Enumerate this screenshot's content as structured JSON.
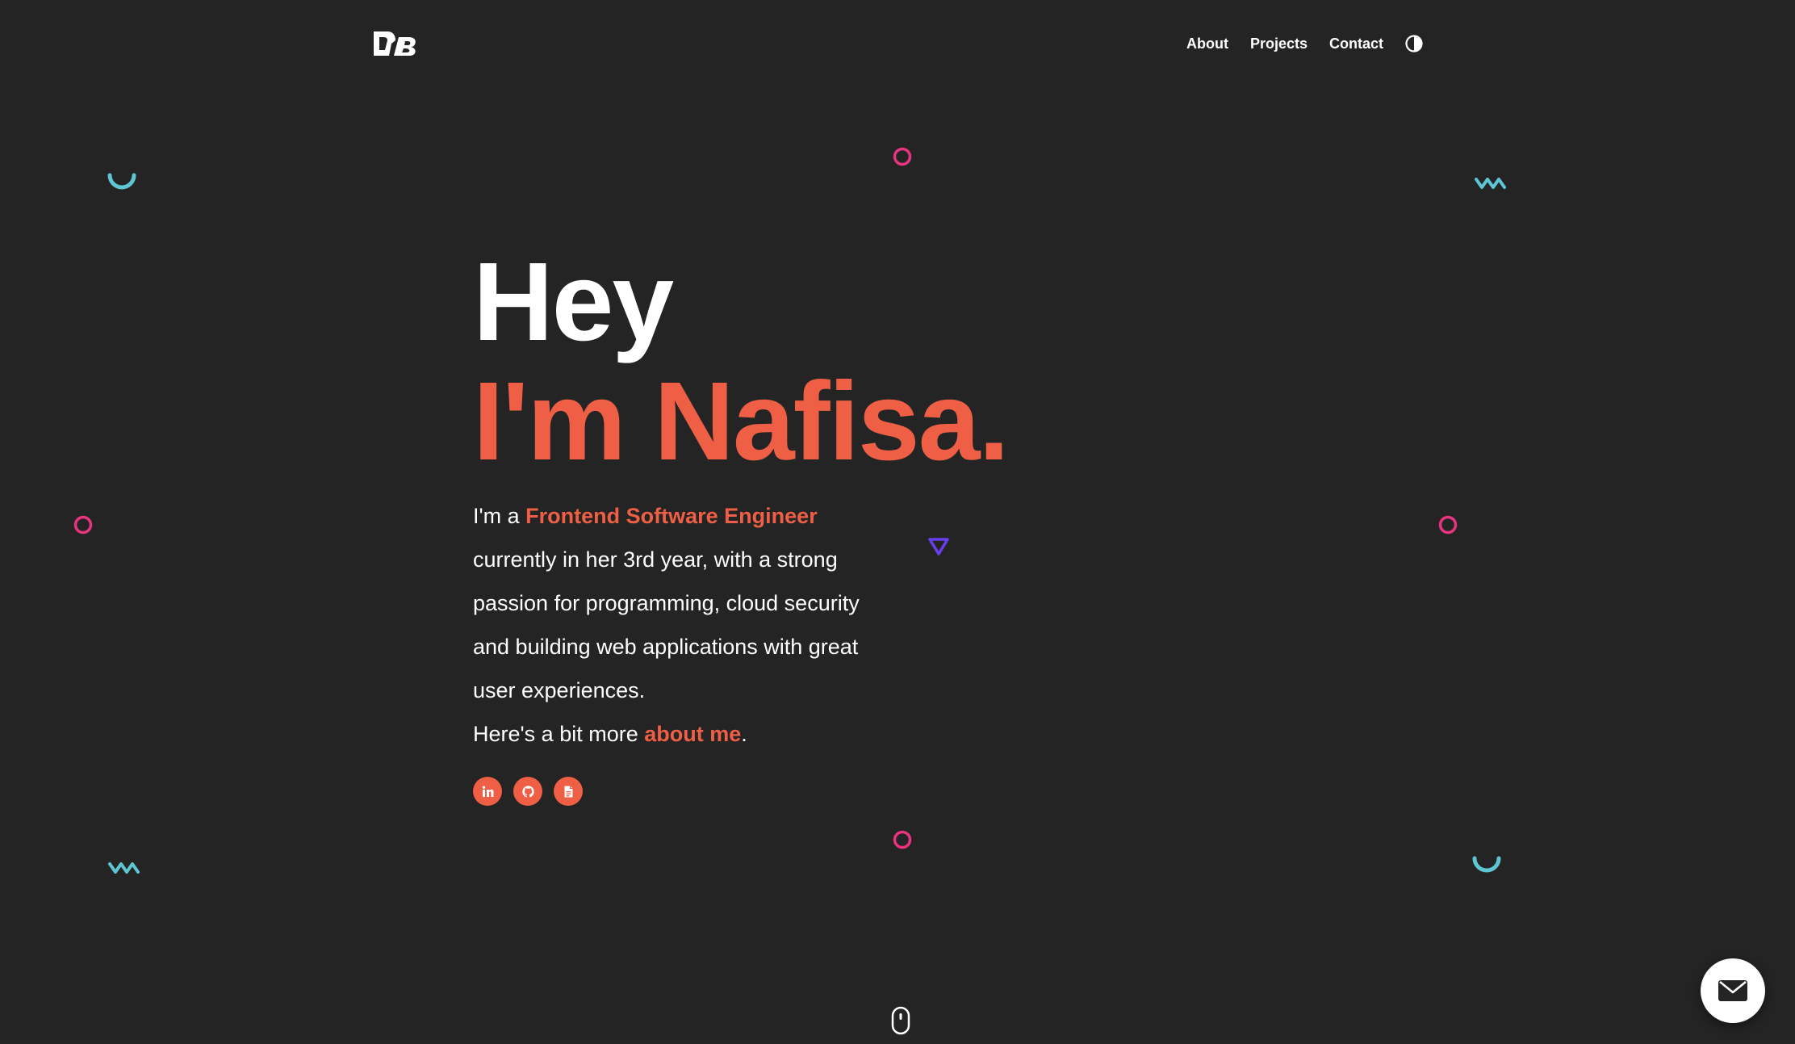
{
  "colors": {
    "background": "#242424",
    "accent": "#ef5f45",
    "text": "#ffffff",
    "pink_shape": "#e8337f",
    "teal_shape": "#5ec6d2",
    "purple_shape": "#6a3df0"
  },
  "header": {
    "logo_icon": "db-monogram-icon",
    "nav": [
      {
        "label": "About"
      },
      {
        "label": "Projects"
      },
      {
        "label": "Contact"
      }
    ],
    "theme_toggle_icon": "half-circle-contrast-icon"
  },
  "hero": {
    "greeting": "Hey",
    "name_line": "I'm Nafisa.",
    "intro_prefix": "I'm a ",
    "role": "Frontend Software Engineer",
    "intro_body": " currently in her 3rd year, with a strong passion for programming, cloud security and building web applications with great user experiences.",
    "more_prefix": "Here's a bit more ",
    "more_link": "about me",
    "more_suffix": ".",
    "socials": [
      {
        "icon": "linkedin-icon"
      },
      {
        "icon": "github-icon"
      },
      {
        "icon": "resume-document-icon"
      }
    ]
  },
  "widgets": {
    "scroll_icon": "mouse-scroll-icon",
    "mail_icon": "envelope-icon"
  }
}
